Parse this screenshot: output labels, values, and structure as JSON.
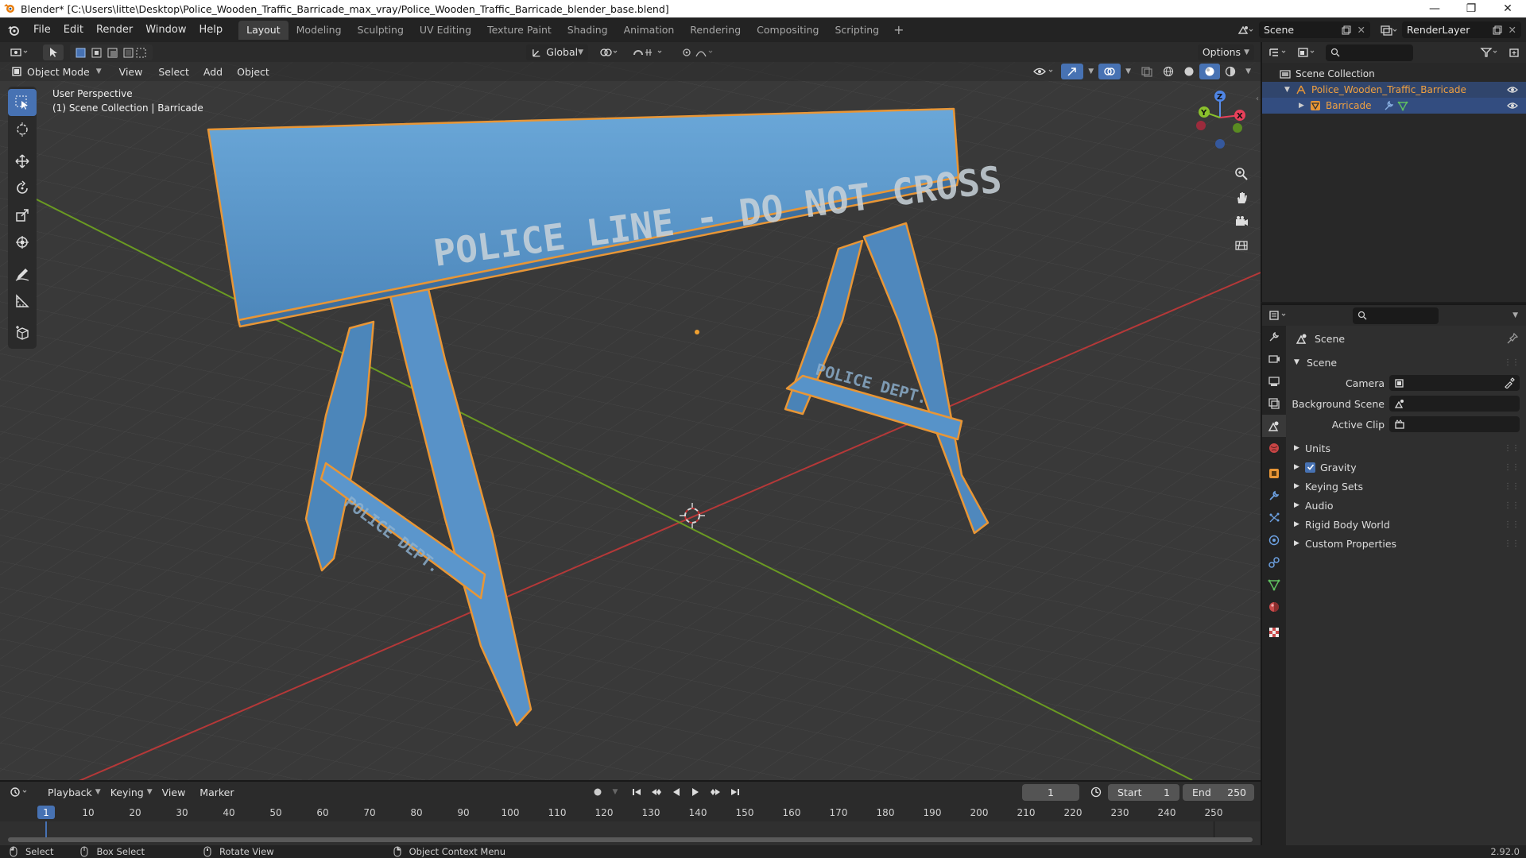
{
  "window": {
    "title": "Blender* [C:\\Users\\litte\\Desktop\\Police_Wooden_Traffic_Barricade_max_vray/Police_Wooden_Traffic_Barricade_blender_base.blend]"
  },
  "menu": [
    "File",
    "Edit",
    "Render",
    "Window",
    "Help"
  ],
  "workspaces": [
    "Layout",
    "Modeling",
    "Sculpting",
    "UV Editing",
    "Texture Paint",
    "Shading",
    "Animation",
    "Rendering",
    "Compositing",
    "Scripting"
  ],
  "active_workspace": "Layout",
  "scene_name": "Scene",
  "view_layer": "RenderLayer",
  "viewport": {
    "transform_orientation": "Global",
    "options_label": "Options",
    "mode": "Object Mode",
    "header_menus": [
      "View",
      "Select",
      "Add",
      "Object"
    ],
    "info_line1": "User Perspective",
    "info_line2": "(1) Scene Collection | Barricade",
    "sign_text": "POLICE LINE - DO NOT CROSS",
    "leg_text": "POLICE DEPT.",
    "gizmo": {
      "z": "Z",
      "y": "Y",
      "x": "X"
    }
  },
  "outliner": {
    "root": "Scene Collection",
    "collection": "Police_Wooden_Traffic_Barricade",
    "object": "Barricade"
  },
  "properties": {
    "context": "Scene",
    "panel": "Scene",
    "camera_label": "Camera",
    "background_label": "Background Scene",
    "clip_label": "Active Clip",
    "sections": [
      "Units",
      "Gravity",
      "Keying Sets",
      "Audio",
      "Rigid Body World",
      "Custom Properties"
    ],
    "gravity_checked": true
  },
  "timeline": {
    "menus": [
      "Playback",
      "Keying",
      "View",
      "Marker"
    ],
    "current_frame": "1",
    "start_label": "Start",
    "start": "1",
    "end_label": "End",
    "end": "250",
    "ruler": [
      "1",
      "10",
      "20",
      "30",
      "40",
      "50",
      "60",
      "70",
      "80",
      "90",
      "100",
      "110",
      "120",
      "130",
      "140",
      "150",
      "160",
      "170",
      "180",
      "190",
      "200",
      "210",
      "220",
      "230",
      "240",
      "250"
    ]
  },
  "status": {
    "select": "Select",
    "box_select": "Box Select",
    "rotate_view": "Rotate View",
    "context_menu": "Object Context Menu",
    "version": "2.92.0"
  },
  "colors": {
    "accent": "#4772b3",
    "selected_outline": "#e89636",
    "barricade": "#5b97cc",
    "grid_bg": "#393939",
    "axis_x": "#b53838",
    "axis_y": "#6a9a22"
  }
}
